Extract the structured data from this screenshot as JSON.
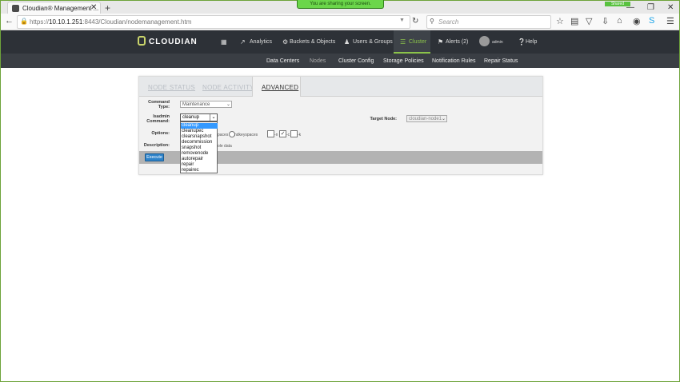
{
  "browser": {
    "tab_title": "Cloudian® Management ...",
    "tab_close": "✕",
    "new_tab": "+",
    "share_banner": "You are sharing your screen.",
    "shared_tag": "Shared",
    "window_controls": {
      "minimize": "—",
      "restore": "❐",
      "close": "✕"
    },
    "url_prefix": "https://",
    "url_host": "10.10.1.251",
    "url_path": ":8443/Cloudian/nodemanagement.htm",
    "search_placeholder": "Search",
    "icons": {
      "back": "back-arrow-icon",
      "reload": "reload-icon",
      "lock": "lock-icon"
    }
  },
  "app": {
    "logo_text": "CLOUDIAN",
    "nav": [
      {
        "label": "Analytics",
        "icon": "chart-icon"
      },
      {
        "label": "Buckets & Objects",
        "icon": "gear-icon"
      },
      {
        "label": "Users & Groups",
        "icon": "users-icon"
      },
      {
        "label": "Cluster",
        "icon": "list-icon"
      },
      {
        "label": "Alerts (2)",
        "icon": "bell-icon"
      },
      {
        "label": "admin",
        "icon": "avatar"
      },
      {
        "label": "Help",
        "icon": "help-icon"
      }
    ],
    "accent": "#8bc34a",
    "header_bg": "#2d3137",
    "subnav": [
      "Data Centers",
      "Nodes",
      "Cluster Config",
      "Storage Policies",
      "Notification Rules",
      "Repair Status"
    ]
  },
  "panel": {
    "tabs": [
      "NODE STATUS",
      "NODE ACTIVITY",
      "ADVANCED"
    ],
    "command_type_label": "Command Type:",
    "command_type_value": "Maintenance",
    "isadmin_label": "Isadmin Command:",
    "isadmin_value": "cleanup",
    "options_label": "Options:",
    "description_label": "Description:",
    "target_node_label": "Target Node:",
    "target_node_value": "cloudian-node1",
    "dropdown_options": [
      "cleanup",
      "cleanupec",
      "clearsnapshot",
      "decommission",
      "snapshot",
      "removenode",
      "autorepair",
      "repair",
      "repairec"
    ],
    "options_fragments": {
      "keyspaces_a": "paces",
      "keyspaces_b": "ndkeyspaces",
      "opt_n": "-n",
      "opt_c": "-c",
      "opt_k": "-k"
    },
    "description_fragment": "ole data",
    "execute_label": "Execute"
  }
}
